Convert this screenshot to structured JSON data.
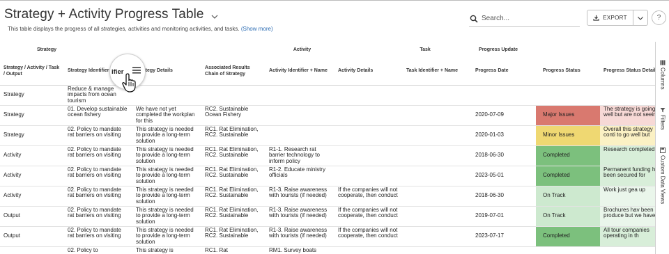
{
  "header": {
    "title": "Strategy + Activity Progress Table",
    "description": "This table displays the progress of all strategies, activities and monitoring activities, and tasks.",
    "show_more": "(Show more)"
  },
  "search": {
    "placeholder": "Search..."
  },
  "toolbar": {
    "export_label": "EXPORT",
    "help_label": "?"
  },
  "column_groups": [
    "Strategy",
    "Activity",
    "Task",
    "Progress Update"
  ],
  "columns": [
    "Strategy / Activity / Task / Output",
    "Strategy Identifier + Name",
    "Strategy Details",
    "Associated Results Chain of Strategy",
    "Activity Identifier + Name",
    "Activity Details",
    "Task Identifier + Name",
    "Progress Date",
    "Progress Status",
    "Progress Status Details"
  ],
  "hover_header_text": "ifier",
  "rows": [
    {
      "level": "Strategy",
      "strategy": "Reduce & manage impacts from ocean tourism",
      "strategy_details": "",
      "results_chain": "",
      "activity": "",
      "activity_details": "",
      "task": "",
      "date": "",
      "status": "",
      "status_details": "",
      "status_class": ""
    },
    {
      "level": "Strategy",
      "strategy": "01. Develop sustainable ocean fishery",
      "strategy_details": "We have not yet completed the workplan for this",
      "results_chain": "RC2. Sustainable Ocean Fishery",
      "activity": "",
      "activity_details": "",
      "task": "",
      "date": "2020-07-09",
      "status": "Major Issues",
      "status_details": "The strategy is going well but are not seeing",
      "status_class": "major"
    },
    {
      "level": "Strategy",
      "strategy": "02. Policy to mandate rat barriers on visiting",
      "strategy_details": "This strategy is needed to provide a long-term solution",
      "results_chain": "RC1. Rat Elimination, RC2. Sustainable",
      "activity": "",
      "activity_details": "",
      "task": "",
      "date": "2020-01-03",
      "status": "Minor Issues",
      "status_details": "Overall this strategy conti to go well but",
      "status_class": "minor"
    },
    {
      "level": "Activity",
      "strategy": "02. Policy to mandate rat barriers on visiting",
      "strategy_details": "This strategy is needed to provide a long-term solution",
      "results_chain": "RC1. Rat Elimination, RC2. Sustainable",
      "activity": "R1-1. Research rat barrier technology to inform policy",
      "activity_details": "",
      "task": "",
      "date": "2018-06-30",
      "status": "Completed",
      "status_details": "Research completed",
      "status_class": "completed"
    },
    {
      "level": "Activity",
      "strategy": "02. Policy to mandate rat barriers on visiting",
      "strategy_details": "This strategy is needed to provide a long-term solution",
      "results_chain": "RC1. Rat Elimination, RC2. Sustainable",
      "activity": "R1-2. Educate ministry officials",
      "activity_details": "",
      "task": "",
      "date": "2023-05-01",
      "status": "Completed",
      "status_details": "Permanent funding has been secured for",
      "status_class": "completed"
    },
    {
      "level": "Activity",
      "strategy": "02. Policy to mandate rat barriers on visiting",
      "strategy_details": "This strategy is needed to provide a long-term solution",
      "results_chain": "RC1. Rat Elimination, RC2. Sustainable",
      "activity": "R1-3. Raise awareness with tourists (if needed)",
      "activity_details": "If the companies will not cooperate, then conduct",
      "task": "",
      "date": "2018-06-30",
      "status": "On Track",
      "status_details": "Work just gea up",
      "status_class": "ontrack"
    },
    {
      "level": "Output",
      "strategy": "02. Policy to mandate rat barriers on visiting",
      "strategy_details": "This strategy is needed to provide a long-term solution",
      "results_chain": "RC1. Rat Elimination, RC2. Sustainable",
      "activity": "R1-3. Raise awareness with tourists (if needed)",
      "activity_details": "If the companies will not cooperate, then conduct",
      "task": "",
      "date": "2019-07-01",
      "status": "On Track",
      "status_details": "Brochures hav been produce but we haven'",
      "status_class": "ontrack"
    },
    {
      "level": "Output",
      "strategy": "02. Policy to mandate rat barriers on visiting",
      "strategy_details": "This strategy is needed to provide a long-term solution",
      "results_chain": "RC1. Rat Elimination, RC2. Sustainable",
      "activity": "R1-3. Raise awareness with tourists (if needed)",
      "activity_details": "If the companies will not cooperate, then conduct",
      "task": "",
      "date": "2023-07-17",
      "status": "Completed",
      "status_details": "All tour companies operating in th",
      "status_class": "completed"
    },
    {
      "level": "",
      "strategy": "02. Policy to",
      "strategy_details": "This strategy is",
      "results_chain": "RC1. Rat",
      "activity": "RM1. Survey boats",
      "activity_details": "",
      "task": "",
      "date": "",
      "status": "",
      "status_details": "",
      "status_class": ""
    }
  ],
  "sidebar": {
    "columns": "Columns",
    "filters": "Filters",
    "custom_views": "Custom Data Views"
  },
  "colors": {
    "major": "#d9796f",
    "minor": "#efd872",
    "completed": "#7cc07d",
    "ontrack": "#cde9cf",
    "link": "#2a6bb3"
  }
}
